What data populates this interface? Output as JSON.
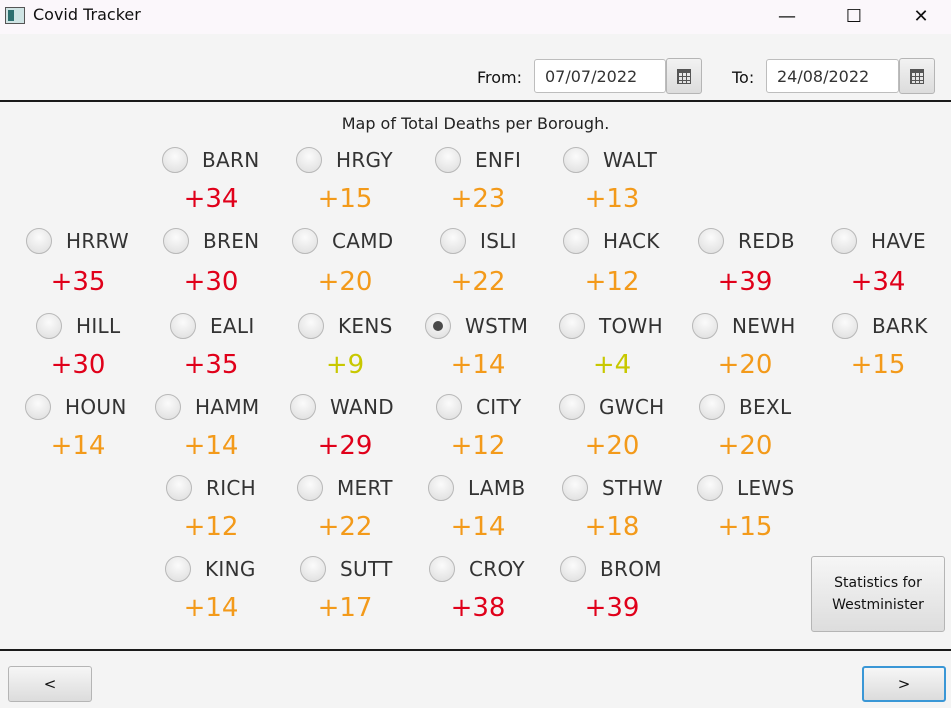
{
  "window": {
    "title": "Covid Tracker",
    "minimize_icon": "minimize-icon",
    "maximize_icon": "maximize-icon",
    "close_icon": "close-icon"
  },
  "toolbar": {
    "from_label": "From:",
    "from_value": "07/07/2022",
    "to_label": "To:",
    "to_value": "24/08/2022",
    "calendar_icon": "calendar-icon"
  },
  "map": {
    "title": "Map of Total Deaths per Borough.",
    "selected": "WSTM",
    "colors": {
      "red": "#e0001a",
      "orange": "#f39a1a",
      "yellow": "#c8c800"
    },
    "boroughs": [
      {
        "code": "BARN",
        "delta": "+34",
        "color": "red"
      },
      {
        "code": "HRGY",
        "delta": "+15",
        "color": "orange"
      },
      {
        "code": "ENFI",
        "delta": "+23",
        "color": "orange"
      },
      {
        "code": "WALT",
        "delta": "+13",
        "color": "orange"
      },
      {
        "code": "HRRW",
        "delta": "+35",
        "color": "red"
      },
      {
        "code": "BREN",
        "delta": "+30",
        "color": "red"
      },
      {
        "code": "CAMD",
        "delta": "+20",
        "color": "orange"
      },
      {
        "code": "ISLI",
        "delta": "+22",
        "color": "orange"
      },
      {
        "code": "HACK",
        "delta": "+12",
        "color": "orange"
      },
      {
        "code": "REDB",
        "delta": "+39",
        "color": "red"
      },
      {
        "code": "HAVE",
        "delta": "+34",
        "color": "red"
      },
      {
        "code": "HILL",
        "delta": "+30",
        "color": "red"
      },
      {
        "code": "EALI",
        "delta": "+35",
        "color": "red"
      },
      {
        "code": "KENS",
        "delta": "+9",
        "color": "yellow"
      },
      {
        "code": "WSTM",
        "delta": "+14",
        "color": "orange"
      },
      {
        "code": "TOWH",
        "delta": "+4",
        "color": "yellow"
      },
      {
        "code": "NEWH",
        "delta": "+20",
        "color": "orange"
      },
      {
        "code": "BARK",
        "delta": "+15",
        "color": "orange"
      },
      {
        "code": "HOUN",
        "delta": "+14",
        "color": "orange"
      },
      {
        "code": "HAMM",
        "delta": "+14",
        "color": "orange"
      },
      {
        "code": "WAND",
        "delta": "+29",
        "color": "red"
      },
      {
        "code": "CITY",
        "delta": "+12",
        "color": "orange"
      },
      {
        "code": "GWCH",
        "delta": "+20",
        "color": "orange"
      },
      {
        "code": "BEXL",
        "delta": "+20",
        "color": "orange"
      },
      {
        "code": "RICH",
        "delta": "+12",
        "color": "orange"
      },
      {
        "code": "MERT",
        "delta": "+22",
        "color": "orange"
      },
      {
        "code": "LAMB",
        "delta": "+14",
        "color": "orange"
      },
      {
        "code": "STHW",
        "delta": "+18",
        "color": "orange"
      },
      {
        "code": "LEWS",
        "delta": "+15",
        "color": "orange"
      },
      {
        "code": "KING",
        "delta": "+14",
        "color": "orange"
      },
      {
        "code": "SUTT",
        "delta": "+17",
        "color": "orange"
      },
      {
        "code": "CROY",
        "delta": "+38",
        "color": "red"
      },
      {
        "code": "BROM",
        "delta": "+39",
        "color": "red"
      }
    ]
  },
  "stats_button": {
    "line1": "Statistics for",
    "line2": "Westminister"
  },
  "nav": {
    "prev_label": "<",
    "next_label": ">"
  }
}
